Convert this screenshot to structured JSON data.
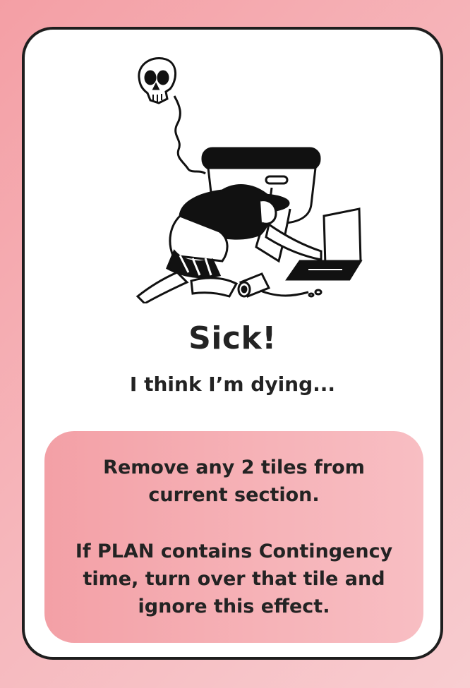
{
  "card": {
    "illustration_icon": "person-sick-over-toilet-with-laptop-and-skull-illustration",
    "title": "Sick!",
    "subtitle": "I think I’m dying...",
    "effect_line_1": "Remove any 2 tiles from",
    "effect_line_2": "current section.",
    "effect_line_3": "If PLAN contains Contingency",
    "effect_line_4": "time, turn over that tile and",
    "effect_line_5": "ignore this effect."
  },
  "colors": {
    "background_pink": "#f6b7bc",
    "effect_box_pink": "#f5aab0",
    "ink": "#232323",
    "card_white": "#ffffff"
  }
}
